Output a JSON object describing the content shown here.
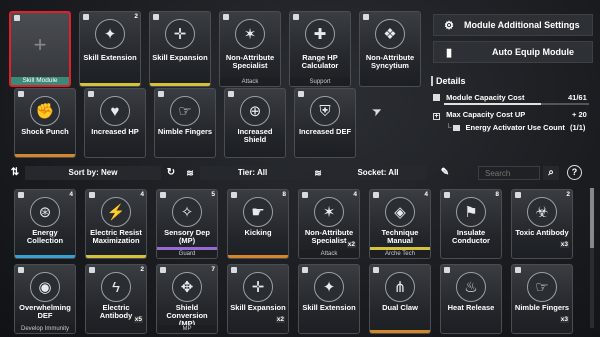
{
  "equipped_top": [
    {
      "label": "Skill Module",
      "sub": "",
      "cost": "",
      "selected": true
    },
    {
      "label": "Skill Extension",
      "sub": "",
      "cost": "2",
      "accent": "#d4c23a",
      "icon": "✦"
    },
    {
      "label": "Skill Expansion",
      "sub": "",
      "cost": "",
      "accent": "#d4c23a",
      "icon": "✛"
    },
    {
      "label": "Non-Attribute Specialist",
      "sub": "Attack",
      "cost": "",
      "icon": "✶"
    },
    {
      "label": "Range HP Calculator",
      "sub": "Support",
      "cost": "",
      "icon": "✚"
    },
    {
      "label": "Non-Attribute Syncytium",
      "sub": "",
      "cost": "",
      "icon": "❖"
    }
  ],
  "equipped_bottom": [
    {
      "label": "Shock Punch",
      "sub": "",
      "cost": "",
      "icon": "✊",
      "accent": "#d4862a"
    },
    {
      "label": "Increased HP",
      "sub": "",
      "cost": "",
      "icon": "♥"
    },
    {
      "label": "Nimble Fingers",
      "sub": "",
      "cost": "",
      "icon": "☞"
    },
    {
      "label": "Increased Shield",
      "sub": "",
      "cost": "",
      "icon": "⊕"
    },
    {
      "label": "Increased DEF",
      "sub": "",
      "cost": "",
      "icon": "⛨"
    }
  ],
  "toolbar": {
    "sort": "Sort by: New",
    "tier": "Tier: All",
    "socket": "Socket: All",
    "search_placeholder": "Search"
  },
  "right_panel": {
    "module_settings": "Module Additional Settings",
    "auto_equip": "Auto Equip Module",
    "details_title": "Details",
    "capacity_cost": "Module Capacity Cost",
    "capacity_value": "41/61",
    "capacity_fraction": 0.672,
    "max_capacity": "Max Capacity Cost UP",
    "max_capacity_value": "+ 20",
    "activator": "Energy Activator Use Count",
    "activator_value": "(1/1)"
  },
  "inventory_row1": [
    {
      "label": "Energy Collection",
      "sub": "",
      "cost": "4",
      "icon": "⊛",
      "accent": "#3aa0d4"
    },
    {
      "label": "Electric Resist Maximization",
      "sub": "",
      "cost": "4",
      "icon": "⚡",
      "accent": "#d4c23a"
    },
    {
      "label": "Sensory Dep (MP)",
      "sub": "Guard",
      "cost": "5",
      "icon": "✧",
      "accent": "#9a6ad4"
    },
    {
      "label": "Kicking",
      "sub": "",
      "cost": "8",
      "icon": "☛",
      "accent": "#d4862a"
    },
    {
      "label": "Non-Attribute Specialist",
      "sub": "Attack",
      "cost": "4",
      "icon": "✶",
      "x": "x2"
    },
    {
      "label": "Technique Manual",
      "sub": "Arche Tech",
      "cost": "4",
      "icon": "◈",
      "accent": "#d4c23a"
    },
    {
      "label": "Insulate Conductor",
      "sub": "",
      "cost": "8",
      "icon": "⚑"
    },
    {
      "label": "Toxic Antibody",
      "sub": "",
      "cost": "2",
      "icon": "☣",
      "x": "x3"
    }
  ],
  "inventory_row2": [
    {
      "label": "Overwhelming DEF",
      "sub": "Develop Immunity",
      "cost": "",
      "icon": "◉"
    },
    {
      "label": "Electric Antibody",
      "sub": "",
      "cost": "2",
      "icon": "ϟ",
      "x": "x5"
    },
    {
      "label": "Shield Conversion (MP)",
      "sub": "MP",
      "cost": "7",
      "icon": "✥"
    },
    {
      "label": "Skill Expansion",
      "sub": "",
      "cost": "",
      "icon": "✛",
      "x": "x2"
    },
    {
      "label": "Skill Extension",
      "sub": "",
      "cost": "",
      "icon": "✦"
    },
    {
      "label": "Dual Claw",
      "sub": "",
      "cost": "",
      "icon": "⋔",
      "accent": "#d4862a"
    },
    {
      "label": "Heat Release",
      "sub": "",
      "cost": "",
      "icon": "♨"
    },
    {
      "label": "Nimble Fingers",
      "sub": "",
      "cost": "",
      "icon": "☞",
      "x": "x3"
    }
  ]
}
